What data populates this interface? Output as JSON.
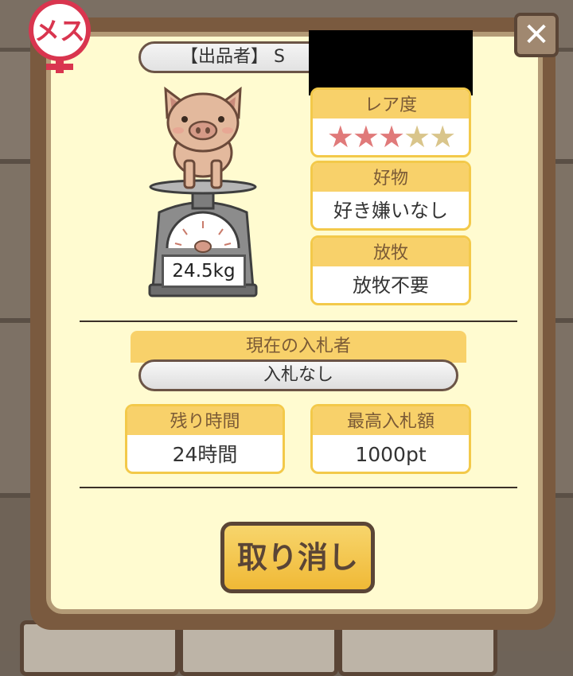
{
  "seller": {
    "label": "【出品者】 S"
  },
  "gender": {
    "badge_text": "メス"
  },
  "close": {
    "label": "✕"
  },
  "pig": {
    "weight": "24.5kg"
  },
  "rarity": {
    "label": "レア度",
    "filled": 3,
    "total": 5,
    "stars": "★★★★★"
  },
  "favorite": {
    "label": "好物",
    "value": "好き嫌いなし"
  },
  "grazing": {
    "label": "放牧",
    "value": "放牧不要"
  },
  "bid": {
    "current_bidder_label": "現在の入札者",
    "current_bidder_value": "入札なし"
  },
  "remaining": {
    "label": "残り時間",
    "value": "24時間"
  },
  "top_bid": {
    "label": "最高入札額",
    "value": "1000pt"
  },
  "actions": {
    "cancel_label": "取り消し"
  },
  "colors": {
    "accent": "#f8d16a",
    "frame": "#7a5a3f",
    "panel_bg": "#fffbd0",
    "star_filled": "#e07a7a",
    "star_empty": "#d9c58b"
  }
}
